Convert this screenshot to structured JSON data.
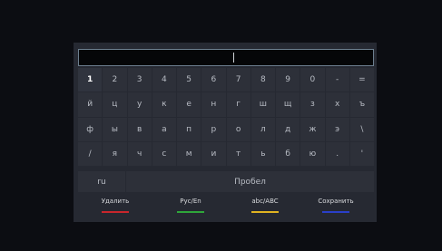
{
  "keyboard": {
    "rows": [
      [
        "1",
        "2",
        "3",
        "4",
        "5",
        "6",
        "7",
        "8",
        "9",
        "0",
        "-",
        "="
      ],
      [
        "й",
        "ц",
        "у",
        "к",
        "е",
        "н",
        "г",
        "ш",
        "щ",
        "з",
        "х",
        "ъ"
      ],
      [
        "ф",
        "ы",
        "в",
        "а",
        "п",
        "р",
        "о",
        "л",
        "д",
        "ж",
        "э",
        "\\"
      ],
      [
        "/",
        "я",
        "ч",
        "с",
        "м",
        "и",
        "т",
        "ь",
        "б",
        "ю",
        ".",
        "'"
      ]
    ],
    "selected_key": "1",
    "language_key": "ru",
    "space_key": "Пробел"
  },
  "input": {
    "value": ""
  },
  "actions": [
    {
      "label": "Удалить",
      "color": "#c8262c"
    },
    {
      "label": "Рус/En",
      "color": "#2fa63a"
    },
    {
      "label": "abc/ABC",
      "color": "#e0b321"
    },
    {
      "label": "Сохранить",
      "color": "#2a3fc9"
    }
  ]
}
